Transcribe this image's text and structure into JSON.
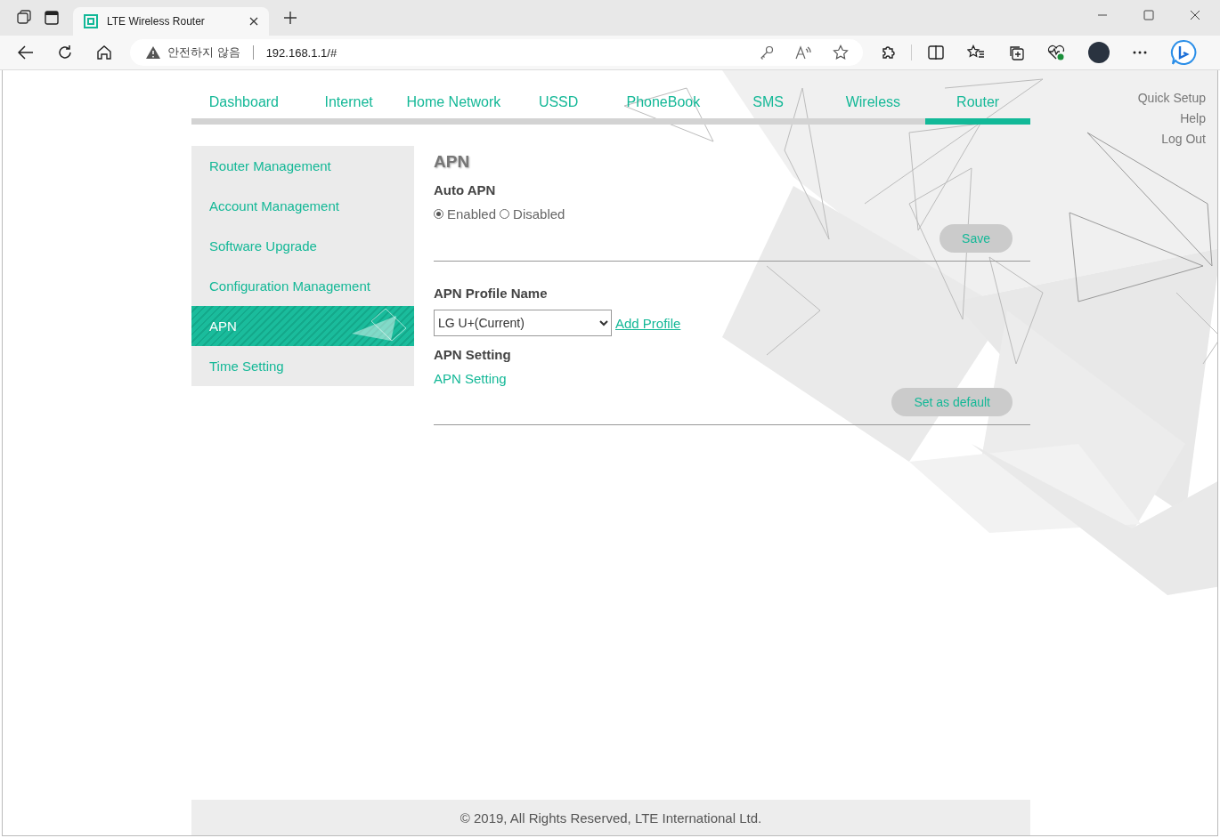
{
  "browser": {
    "tabs": [
      {
        "title": "LTE Wireless Router",
        "selected": true
      }
    ],
    "address": {
      "warning": "안전하지 않음",
      "url": "192.168.1.1/#"
    }
  },
  "nav": [
    {
      "label": "Dashboard",
      "selected": false
    },
    {
      "label": "Internet",
      "selected": false
    },
    {
      "label": "Home Network",
      "selected": false
    },
    {
      "label": "USSD",
      "selected": false
    },
    {
      "label": "PhoneBook",
      "selected": false
    },
    {
      "label": "SMS",
      "selected": false
    },
    {
      "label": "Wireless",
      "selected": false
    },
    {
      "label": "Router",
      "selected": true
    }
  ],
  "top_links": [
    "Quick Setup",
    "Help",
    "Log Out"
  ],
  "sidebar": [
    {
      "label": "Router Management",
      "selected": false
    },
    {
      "label": "Account Management",
      "selected": false
    },
    {
      "label": "Software Upgrade",
      "selected": false
    },
    {
      "label": "Configuration Management",
      "selected": false
    },
    {
      "label": "APN",
      "selected": true
    },
    {
      "label": "Time Setting",
      "selected": false
    }
  ],
  "content": {
    "title": "APN",
    "auto_apn": {
      "label": "Auto APN",
      "options": [
        {
          "label": "Enabled",
          "selected": true
        },
        {
          "label": "Disabled",
          "selected": false
        }
      ],
      "button": "Save"
    },
    "profile": {
      "label": "APN Profile Name",
      "value": "LG U+(Current)",
      "link": "Add Profile"
    },
    "apn_setting": {
      "label": "APN Setting",
      "link": "APN Setting",
      "button": "Set as default"
    }
  },
  "footer": "© 2019, All Rights Reserved, LTE International Ltd."
}
